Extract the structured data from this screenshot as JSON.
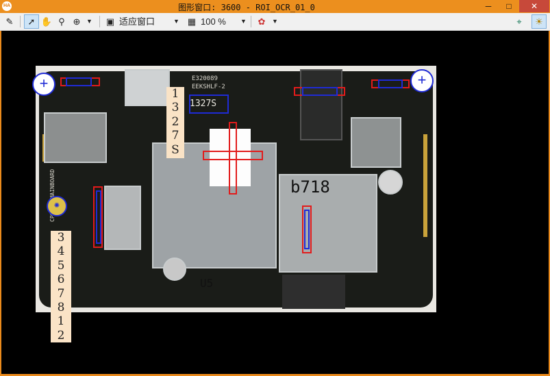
{
  "window": {
    "title": "图形窗口: 3600 - ROI_OCR_01_0",
    "logo": "HA"
  },
  "window_controls": {
    "minimize": "─",
    "maximize": "□",
    "close": "✕"
  },
  "toolbar": {
    "fit_label": "适应窗口",
    "zoom_label": "100 %",
    "icons": [
      "edit-icon",
      "pointer-icon",
      "pan-hand-icon",
      "zoom-magnifier-icon",
      "zoom-plus-icon",
      "fit-window-icon",
      "zoom-icon",
      "color-tool-icon",
      "roi-inspect-icon",
      "lightbulb-icon"
    ]
  },
  "ocr_results": {
    "top_string": [
      "1",
      "3",
      "2",
      "7",
      "S"
    ],
    "left_string": [
      "3",
      "4",
      "5",
      "6",
      "7",
      "8",
      "1",
      "2"
    ]
  },
  "pcb_markings": {
    "label_code": "1327S",
    "cert": "E320089",
    "part": "EEKSHLF-2",
    "card_mark": "b718",
    "board_name": "CP8750_MAINBOARD",
    "ul_mark": "U5"
  }
}
